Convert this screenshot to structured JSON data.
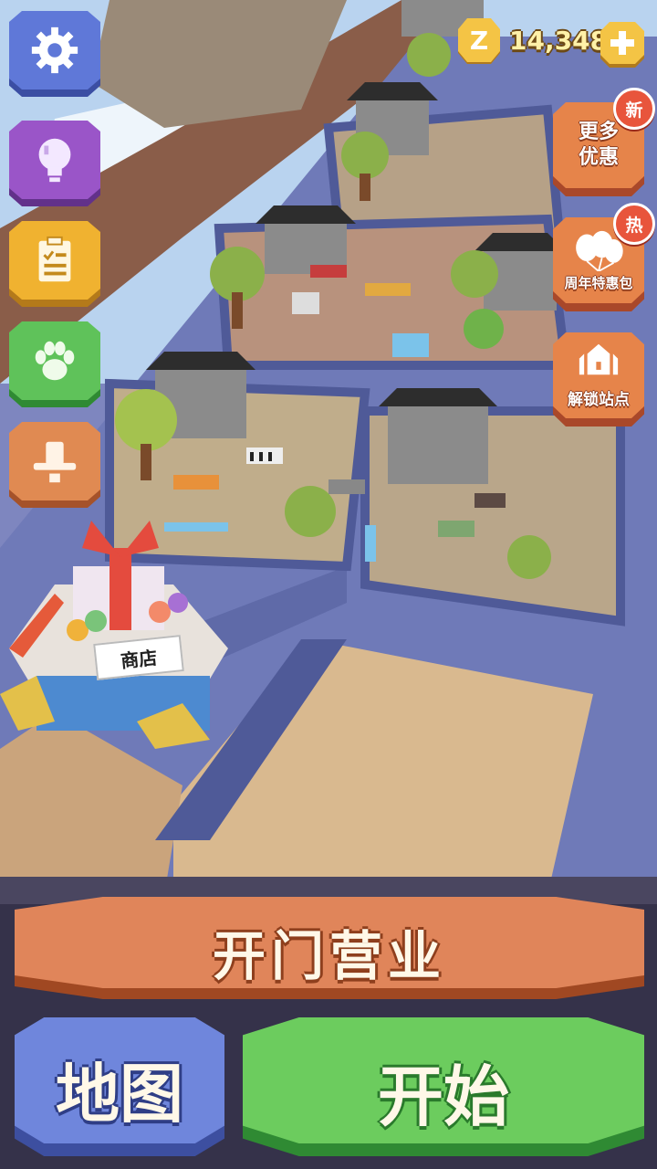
{
  "currency": {
    "value": "14,348",
    "icon": "z-coin-icon"
  },
  "side_menu": [
    {
      "name": "settings",
      "icon": "gear-icon",
      "color": "#5f78d8",
      "shadow": "#3b4ea3"
    },
    {
      "name": "tips",
      "icon": "lightbulb-icon",
      "color": "#9a55c8",
      "shadow": "#62318a"
    },
    {
      "name": "tasks",
      "icon": "clipboard-icon",
      "color": "#f0b230",
      "shadow": "#b47a1a"
    },
    {
      "name": "animals",
      "icon": "paw-icon",
      "color": "#5fc25a",
      "shadow": "#2f8a33"
    },
    {
      "name": "ranger",
      "icon": "cowboy-hat-icon",
      "color": "#e08a52",
      "shadow": "#a5522a"
    }
  ],
  "offers": [
    {
      "label_line1": "更多",
      "label_line2": "优惠",
      "badge": "新"
    },
    {
      "label": "周年特惠包",
      "badge": "热"
    },
    {
      "label": "解锁站点"
    }
  ],
  "shop": {
    "sign": "商店"
  },
  "buttons": {
    "open": "开门营业",
    "map": "地图",
    "start": "开始"
  }
}
